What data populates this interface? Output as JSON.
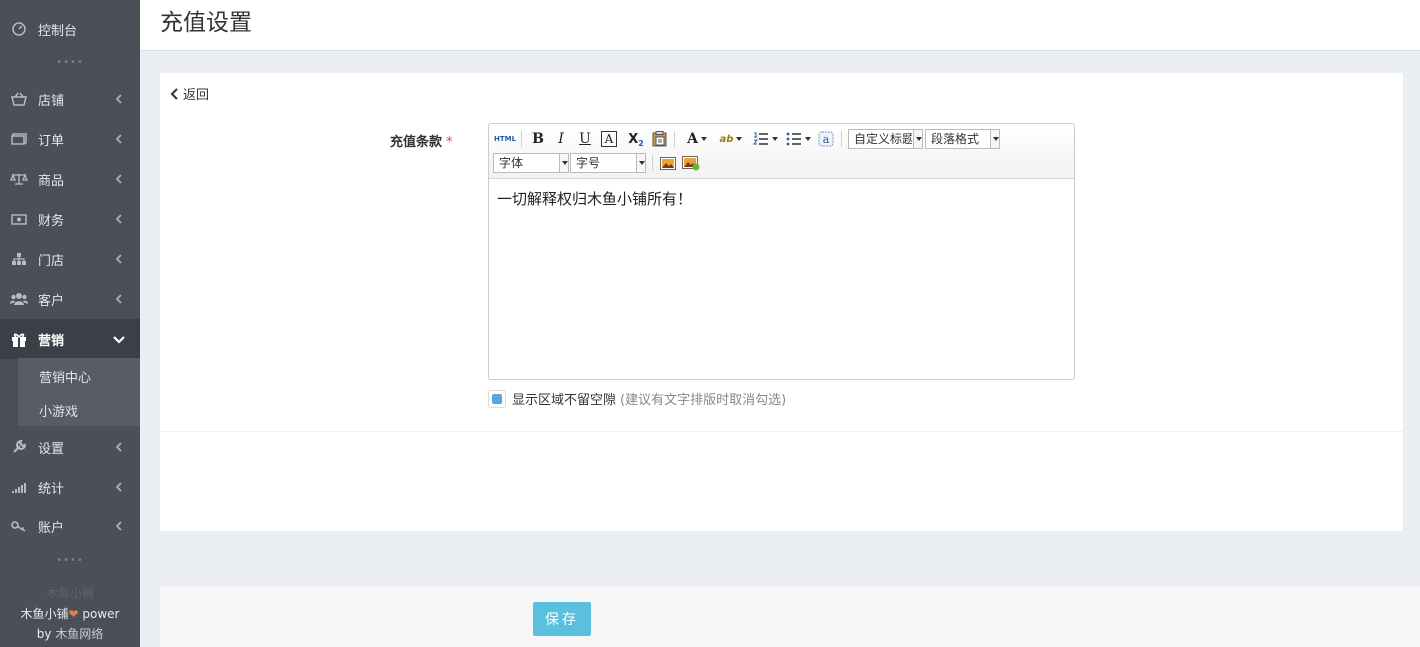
{
  "sidebar": {
    "items": [
      {
        "label": "控制台",
        "icon": "dashboard-icon"
      },
      {
        "label": "店铺",
        "icon": "basket-icon"
      },
      {
        "label": "订单",
        "icon": "ticket-icon"
      },
      {
        "label": "商品",
        "icon": "scale-icon"
      },
      {
        "label": "财务",
        "icon": "money-icon"
      },
      {
        "label": "门店",
        "icon": "sitemap-icon"
      },
      {
        "label": "客户",
        "icon": "users-icon"
      },
      {
        "label": "营销",
        "icon": "gift-icon"
      },
      {
        "label": "设置",
        "icon": "wrench-icon"
      },
      {
        "label": "统计",
        "icon": "signal-icon"
      },
      {
        "label": "账户",
        "icon": "key-icon"
      }
    ],
    "sub_items": [
      "营销中心",
      "小游戏"
    ],
    "dots": "••••",
    "brand_faint": "木鱼小铺",
    "brand_line1": "木鱼小铺",
    "brand_heart": "❤",
    "brand_power": " power",
    "brand_by": "by ",
    "brand_link": "木鱼网络"
  },
  "header": {
    "title": "充值设置"
  },
  "main": {
    "back_label": "返回",
    "field_label": "充值条款",
    "required_mark": "*",
    "editor": {
      "content": "一切解释权归木鱼小铺所有！",
      "html_label": "HTML",
      "bold": "B",
      "italic": "I",
      "underline": "U",
      "border_letter": "A",
      "subscript": "X",
      "subscript_sub": "2",
      "font_color": "A",
      "highlight": "ab",
      "custom_heading": "自定义标题",
      "paragraph_format": "段落格式",
      "font_family": "字体",
      "font_size": "字号"
    },
    "checkbox_label": "显示区域不留空隙",
    "checkbox_hint": "(建议有文字排版时取消勾选)",
    "checkbox_checked": true
  },
  "footer": {
    "save_label": "保存"
  },
  "colors": {
    "sidebar": "#4a4f58",
    "accent": "#5bc0de",
    "checkbox": "#58a5dc",
    "required": "#e4393c"
  }
}
